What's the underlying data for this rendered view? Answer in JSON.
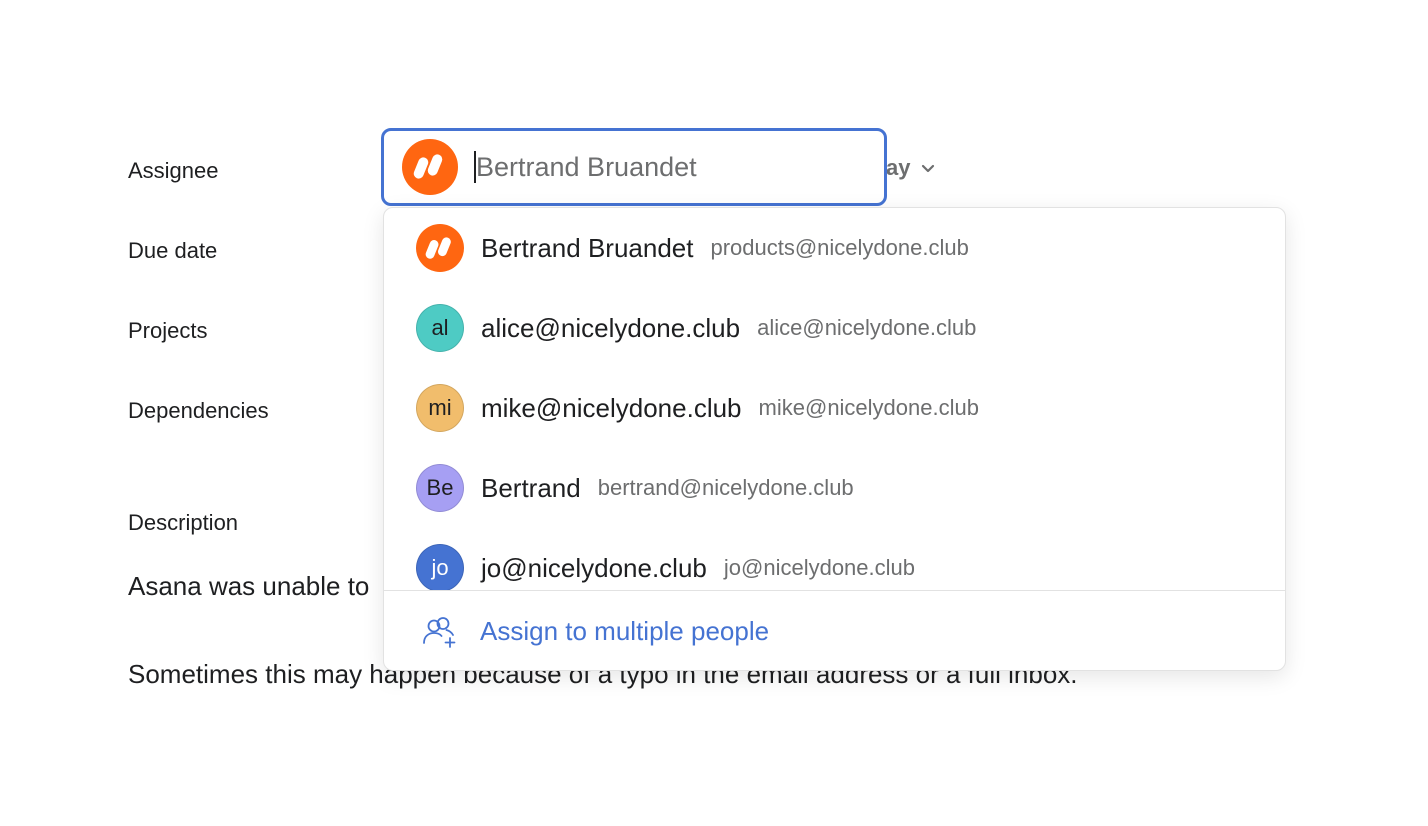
{
  "fields": {
    "assignee": "Assignee",
    "due_date": "Due date",
    "projects": "Projects",
    "dependencies": "Dependencies",
    "description": "Description"
  },
  "assignee_input": {
    "value": "",
    "placeholder": "Bertrand Bruandet",
    "avatar_icon": "brand-logo-icon"
  },
  "hidden_trail_text": "ay",
  "description": {
    "line1": "Asana was unable to",
    "line2": "Sometimes this may happen because of a typo in the email address or a full inbox."
  },
  "dropdown": {
    "items": [
      {
        "initials": "",
        "name": "Bertrand Bruandet",
        "email": "products@nicelydone.club",
        "color": "#ff6611",
        "logo": true
      },
      {
        "initials": "al",
        "name": "alice@nicelydone.club",
        "email": "alice@nicelydone.club",
        "color": "#4ecbc4"
      },
      {
        "initials": "mi",
        "name": "mike@nicelydone.club",
        "email": "mike@nicelydone.club",
        "color": "#f1bd6c"
      },
      {
        "initials": "Be",
        "name": "Bertrand",
        "email": "bertrand@nicelydone.club",
        "color": "#a69ff3"
      },
      {
        "initials": "jo",
        "name": "jo@nicelydone.club",
        "email": "jo@nicelydone.club",
        "color": "#4573d2"
      }
    ],
    "footer_label": "Assign to multiple people",
    "footer_icon": "add-people-icon"
  },
  "colors": {
    "accent": "#4573d2",
    "brand": "#ff6611",
    "text": "#1e1f21",
    "muted": "#6d6e6f"
  }
}
